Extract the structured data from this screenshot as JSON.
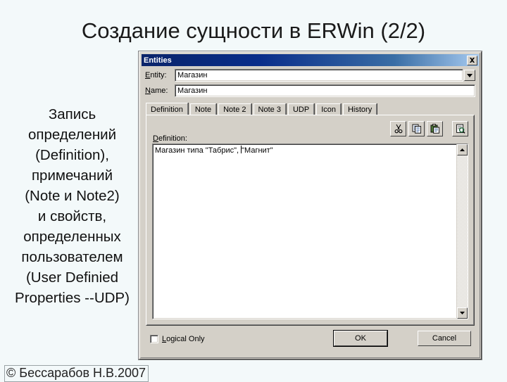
{
  "slide": {
    "title": "Создание сущности в ERWin (2/2)",
    "body_text_lines": [
      "Запись",
      "определений",
      "(Definition),",
      "примечаний",
      "(Note и Note2)",
      "и свойств,",
      "определенных",
      "пользователем",
      "(User Definied",
      "Properties --UDP)"
    ],
    "footer": "© Бессарабов Н.В.2007",
    "background_color": "#f3f9fa"
  },
  "dialog": {
    "title": "Entities",
    "close_icon": "close-icon",
    "titlebar_color_start": "#0a246a",
    "titlebar_color_end": "#a6caf0",
    "face_color": "#d4d0c8",
    "entity": {
      "label": "Entity:",
      "value": "Магазин",
      "placeholder": "",
      "dropdown_icon": "chevron-down-icon"
    },
    "name": {
      "label": "Name:",
      "value": "Магазин",
      "placeholder": ""
    },
    "tabs": [
      {
        "label": "Definition",
        "active": true
      },
      {
        "label": "Note",
        "active": false
      },
      {
        "label": "Note 2",
        "active": false
      },
      {
        "label": "Note 3",
        "active": false
      },
      {
        "label": "UDP",
        "active": false
      },
      {
        "label": "Icon",
        "active": false
      },
      {
        "label": "History",
        "active": false
      }
    ],
    "toolbar": [
      {
        "name": "cut-icon",
        "tooltip": "Cut"
      },
      {
        "name": "copy-icon",
        "tooltip": "Copy"
      },
      {
        "name": "paste-icon",
        "tooltip": "Paste"
      },
      {
        "name": "preview-icon",
        "tooltip": "Preview"
      }
    ],
    "definition": {
      "label": "Definition:",
      "text_before_caret": "Магазин типа \"Табрис\", ",
      "text_after_caret": "\"Магнит\"",
      "full_text": "Магазин типа \"Табрис\", \"Магнит\""
    },
    "scrollbar": {
      "up_icon": "scroll-up-icon",
      "down_icon": "scroll-down-icon"
    },
    "logical_only": {
      "label": "Logical Only",
      "checked": false
    },
    "buttons": {
      "ok": "OK",
      "cancel": "Cancel"
    }
  }
}
